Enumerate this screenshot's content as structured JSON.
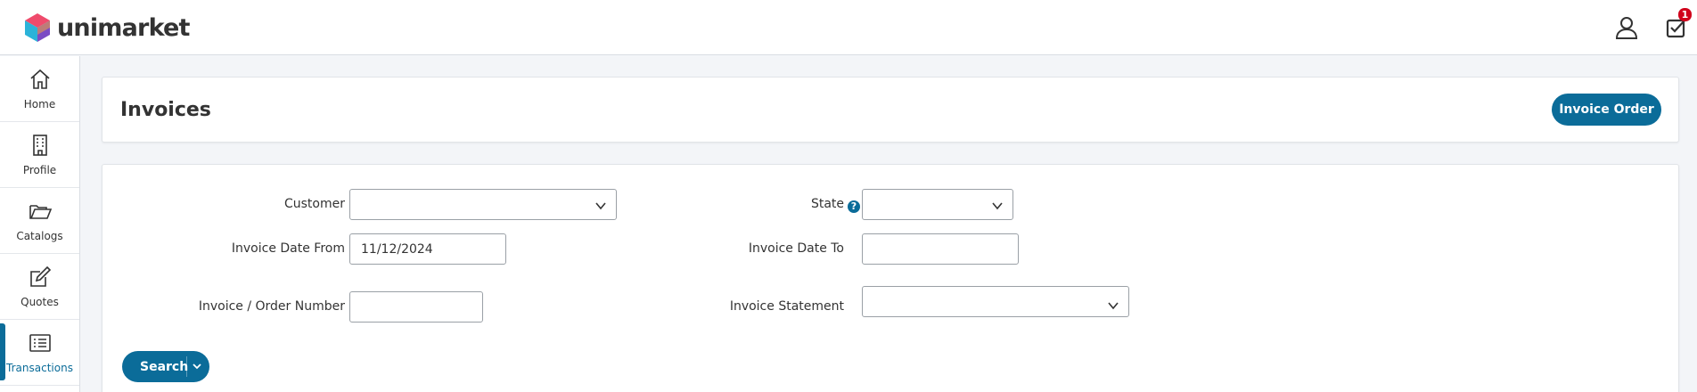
{
  "app": {
    "logo_text": "unimarket",
    "notification_count": "1",
    "colors": {
      "accent": "#0b6c99",
      "badge": "#d0021b"
    }
  },
  "sidebar": {
    "items": [
      {
        "label": "Home",
        "icon": "home-icon"
      },
      {
        "label": "Profile",
        "icon": "building-icon"
      },
      {
        "label": "Catalogs",
        "icon": "folder-icon"
      },
      {
        "label": "Quotes",
        "icon": "edit-icon"
      },
      {
        "label": "Transactions",
        "icon": "list-icon",
        "active": true
      }
    ]
  },
  "header": {
    "title": "Invoices",
    "invoice_order_label": "Invoice Order"
  },
  "filters": {
    "customer_label": "Customer",
    "customer_value": "",
    "state_label": "State",
    "state_value": "",
    "date_from_label": "Invoice Date From",
    "date_from_value": "11/12/2024",
    "date_to_label": "Invoice Date To",
    "date_to_value": "",
    "number_label": "Invoice / Order Number",
    "number_value": "",
    "statement_label": "Invoice Statement",
    "statement_value": "",
    "search_label": "Search"
  }
}
